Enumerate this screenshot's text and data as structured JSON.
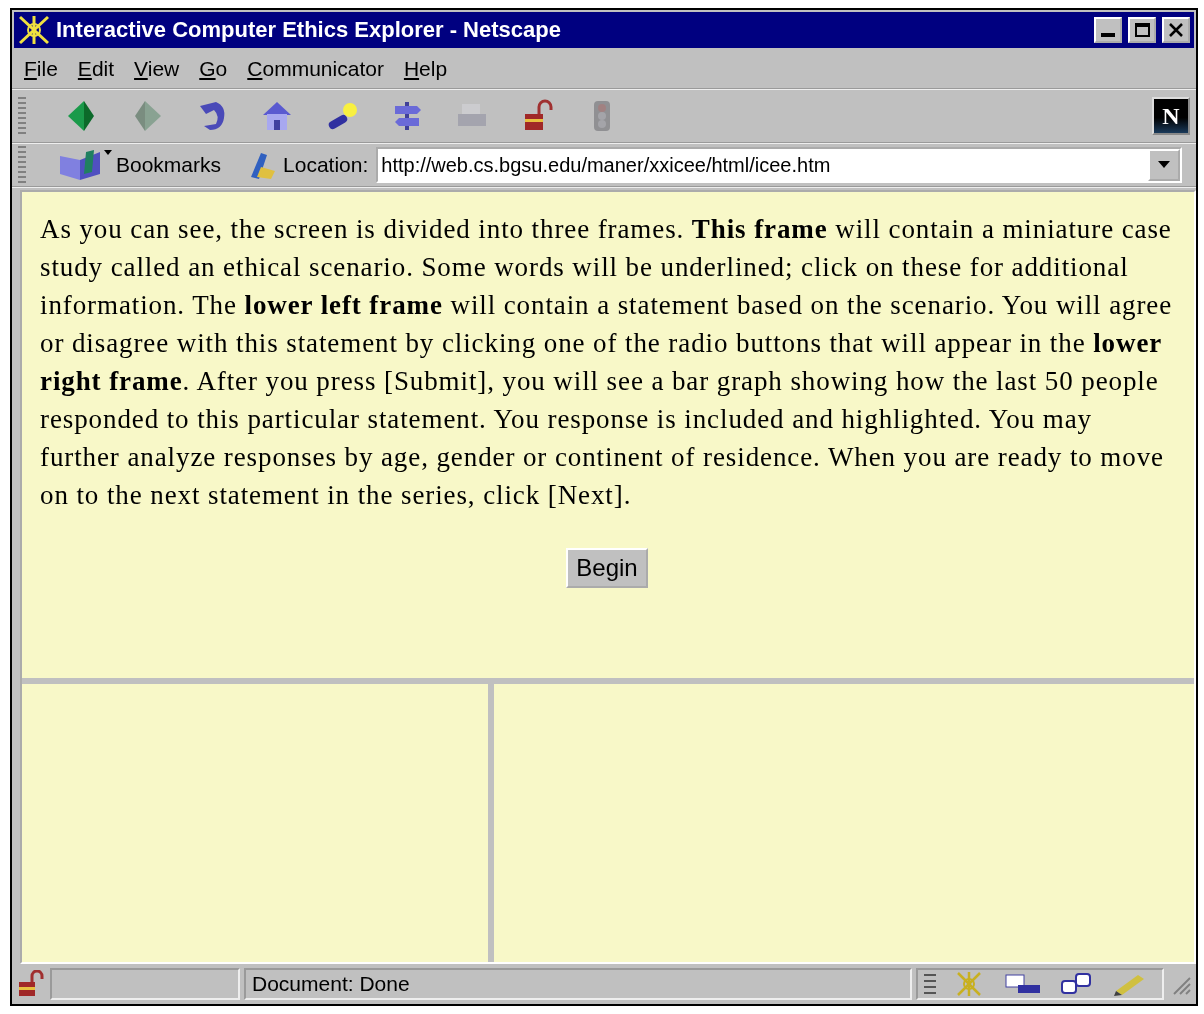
{
  "window": {
    "title": "Interactive Computer Ethics Explorer - Netscape"
  },
  "menu": [
    {
      "label": "File"
    },
    {
      "label": "Edit"
    },
    {
      "label": "View"
    },
    {
      "label": "Go"
    },
    {
      "label": "Communicator"
    },
    {
      "label": "Help"
    }
  ],
  "toolbar": {
    "buttons": [
      {
        "kind": "back",
        "disabled": false
      },
      {
        "kind": "forward",
        "disabled": true
      },
      {
        "kind": "reload",
        "disabled": false
      },
      {
        "kind": "home",
        "disabled": false
      },
      {
        "kind": "search",
        "disabled": false
      },
      {
        "kind": "guide",
        "disabled": false
      },
      {
        "kind": "print",
        "disabled": true
      },
      {
        "kind": "security",
        "disabled": false
      },
      {
        "kind": "stop",
        "disabled": true
      }
    ],
    "logo": "N"
  },
  "location_bar": {
    "bookmarks": "Bookmarks",
    "label": "Location:",
    "url": "http://web.cs.bgsu.edu/maner/xxicee/html/icee.htm"
  },
  "top_frame": {
    "paragraph": "As you can see, the screen is divided into three frames. **This frame** will contain a miniature case study called an ethical scenario. Some words will be underlined; click on these for additional information. The **lower left frame** will contain a statement based on the scenario. You will agree or disagree with this statement by clicking one of the radio buttons that will appear in the **lower right frame**. After you press [Submit], you will see a bar graph showing how the last 50 people responded to this particular statement. You response is included and highlighted. You may further analyze responses by age, gender or continent of residence. When you are ready to move on to the next statement in the series, click [Next].",
    "button": "Begin"
  },
  "status_bar": {
    "text": "Document: Done"
  }
}
